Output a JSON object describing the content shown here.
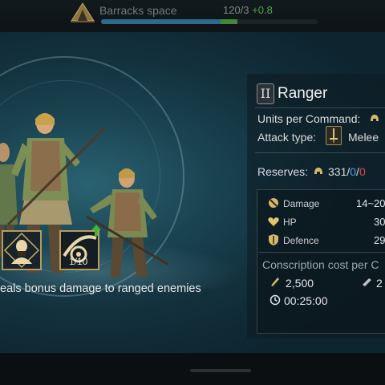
{
  "topbar": {
    "label": "Barracks space",
    "count": "120/3",
    "added": "+0.8",
    "icon": "tent-icon",
    "fill_fraction": 0.55,
    "added_fraction": 0.08
  },
  "bonus": {
    "description": "eals bonus damage to ranged enemies",
    "icons": [
      "cavalry-leader-icon",
      "bow-target-icon"
    ],
    "level": "1/10",
    "upgrade_icon": "upgrade-arrow-icon"
  },
  "unit": {
    "class_numeral": "II",
    "name": "Ranger",
    "units_per_command_label": "Units per Command:",
    "attack_type_label": "Attack type:",
    "attack_type_value": "Melee",
    "reserves_label": "Reserves:",
    "reserves_main": "331",
    "reserves_sep1": "/",
    "reserves_blue": "0",
    "reserves_sep2": "/",
    "reserves_red": "0"
  },
  "stats": {
    "damage_label": "Damage",
    "damage_value": "14~20",
    "hp_label": "HP",
    "hp_value": "30",
    "defence_label": "Defence",
    "defence_value": "29"
  },
  "cost": {
    "title": "Conscription cost per C",
    "food": "2,500",
    "wood": "2",
    "time": "00:25:00"
  },
  "colors": {
    "accent_gold": "#b79a5e",
    "reserves_blue": "#4aa0e6",
    "reserves_red": "#e04848"
  }
}
